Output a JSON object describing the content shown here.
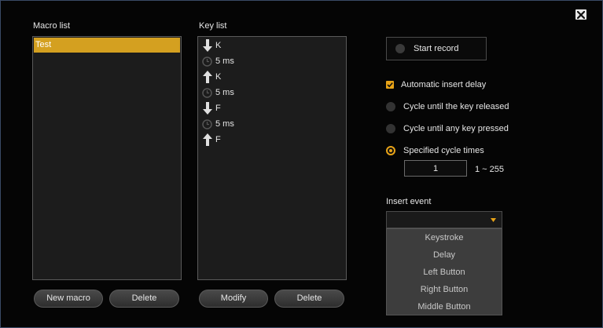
{
  "window": {
    "close_label": "×"
  },
  "macro_list": {
    "title": "Macro list",
    "items": [
      "Test"
    ]
  },
  "key_list": {
    "title": "Key list",
    "items": [
      {
        "icon": "arrow-down-icon",
        "text": "K"
      },
      {
        "icon": "clock-icon",
        "text": "5 ms"
      },
      {
        "icon": "arrow-up-icon",
        "text": "K"
      },
      {
        "icon": "clock-icon",
        "text": "5 ms"
      },
      {
        "icon": "arrow-down-icon",
        "text": "F"
      },
      {
        "icon": "clock-icon",
        "text": "5 ms"
      },
      {
        "icon": "arrow-up-icon",
        "text": "F"
      }
    ]
  },
  "buttons": {
    "new_macro": "New macro",
    "delete_macro": "Delete",
    "modify": "Modify",
    "delete_key": "Delete"
  },
  "record": {
    "label": "Start record"
  },
  "options": {
    "auto_delay": {
      "label": "Automatic insert delay",
      "checked": true
    },
    "cycle_released": {
      "label": "Cycle until the key released",
      "selected": false
    },
    "cycle_any": {
      "label": "Cycle until any key pressed",
      "selected": false
    },
    "cycle_times": {
      "label": "Specified cycle times",
      "selected": true
    }
  },
  "cycle": {
    "value": "1",
    "range": "1 ~ 255"
  },
  "insert_event": {
    "label": "Insert event",
    "selected": "",
    "options": [
      "Keystroke",
      "Delay",
      "Left Button",
      "Right Button",
      "Middle Button"
    ]
  },
  "colors": {
    "accent": "#e8a317",
    "selection": "#d4a020"
  }
}
